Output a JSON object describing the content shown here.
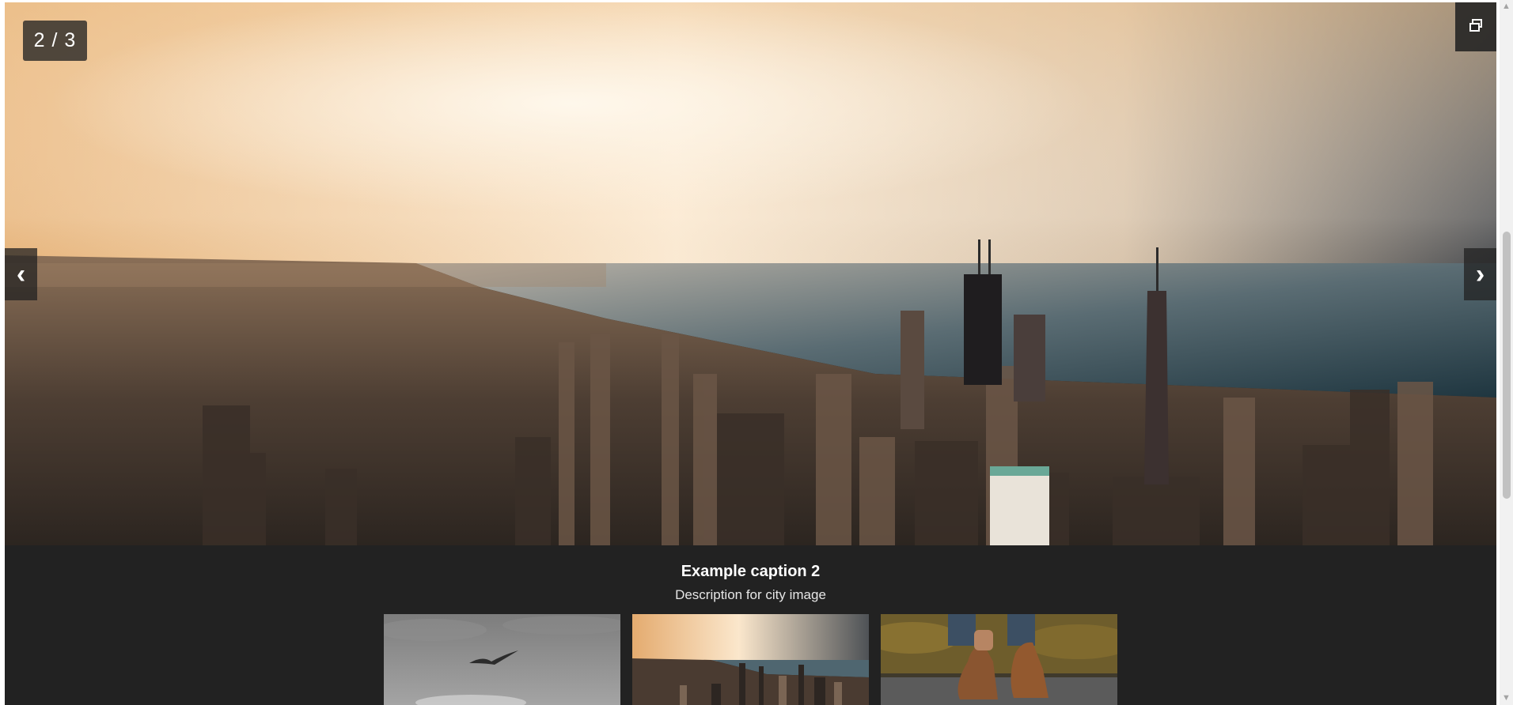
{
  "gallery": {
    "counter": "2 / 3",
    "prev_arrow": "‹",
    "next_arrow": "›",
    "fullscreen_icon": "restore-window-icon",
    "caption": {
      "title": "Example caption 2",
      "description": "Description for city image"
    },
    "thumbnails": [
      {
        "name": "bird-sky",
        "active": false
      },
      {
        "name": "city-skyline",
        "active": true
      },
      {
        "name": "boots",
        "active": false
      }
    ]
  },
  "scrollbar": {
    "up_arrow": "▲",
    "down_arrow": "▼"
  }
}
